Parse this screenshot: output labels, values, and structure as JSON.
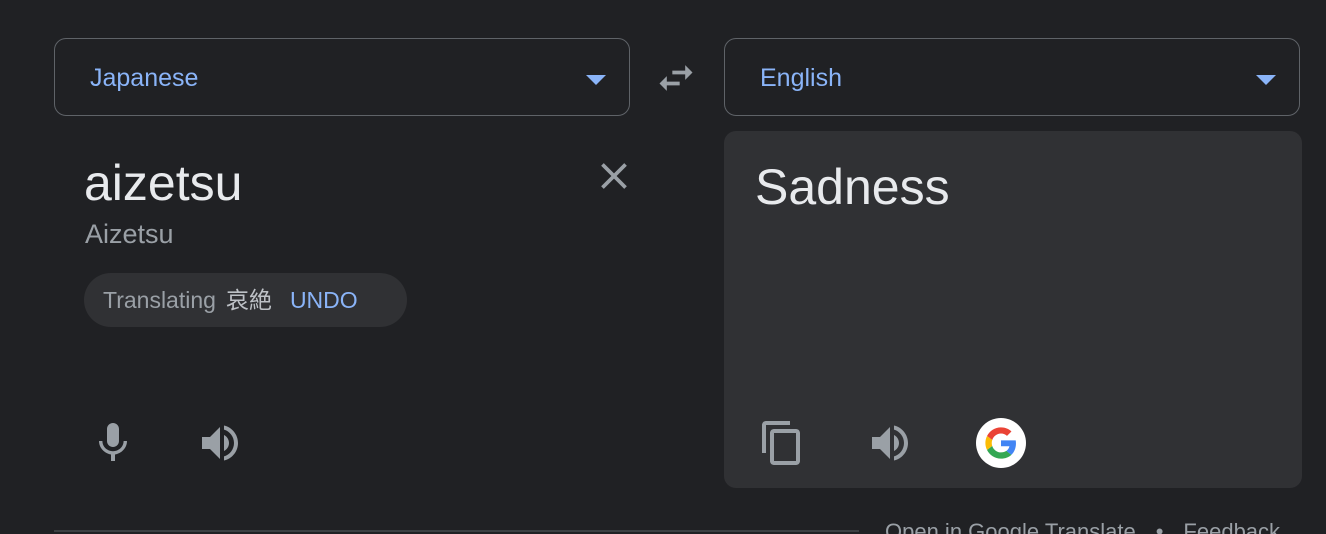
{
  "source_language": {
    "label": "Japanese"
  },
  "target_language": {
    "label": "English"
  },
  "source": {
    "text": "aizetsu",
    "transliteration": "Aizetsu",
    "chip": {
      "prefix": "Translating",
      "word": "哀絶",
      "undo_label": "UNDO"
    }
  },
  "target": {
    "text": "Sadness"
  },
  "footer": {
    "open_link": "Open in Google Translate",
    "separator": "•",
    "feedback_link": "Feedback"
  },
  "colors": {
    "background": "#202124",
    "accent": "#8ab4f8",
    "panel": "#303134",
    "text_primary": "#e8eaed",
    "text_secondary": "#9aa0a6"
  },
  "icons": {
    "swap": "swap-horiz-icon",
    "clear": "close-icon",
    "mic": "microphone-icon",
    "speaker": "speaker-icon",
    "copy": "copy-icon",
    "google": "google-g-icon"
  }
}
